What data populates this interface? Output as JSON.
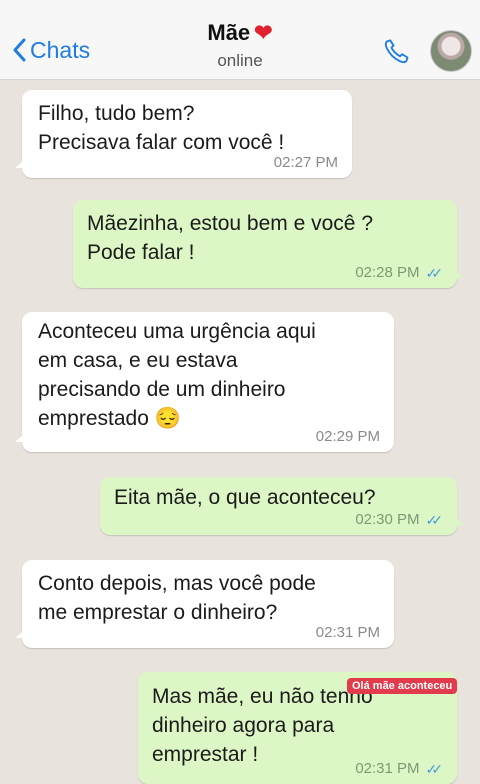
{
  "header": {
    "back_label": "Chats",
    "contact_name": "Mãe",
    "contact_emoji": "❤",
    "status": "online"
  },
  "messages": [
    {
      "direction": "in",
      "text": "Filho, tudo bem?\nPrecisava falar com você !",
      "time": "02:27 PM"
    },
    {
      "direction": "out",
      "text": "Mãezinha, estou bem e você ?\nPode falar !",
      "time": "02:28 PM"
    },
    {
      "direction": "in",
      "text": "Aconteceu uma urgência aqui\nem casa, e eu estava\nprecisando de um dinheiro\nemprestado 😔",
      "time": "02:29 PM"
    },
    {
      "direction": "out",
      "text": "Eita mãe, o que aconteceu?",
      "time": "02:30 PM"
    },
    {
      "direction": "in",
      "text": "Conto depois, mas você pode\nme emprestar o dinheiro?",
      "time": "02:31 PM"
    },
    {
      "direction": "out",
      "text": "Mas mãe, eu não tenho\ndinheiro agora para\nemprestar !",
      "time": "02:31 PM"
    }
  ],
  "overlay_label": "Olá mãe aconteceu",
  "colors": {
    "accent": "#1f7ce0",
    "outgoing_bubble": "#dcf7c5",
    "incoming_bubble": "#ffffff",
    "read_ticks": "#4a9cdf",
    "background": "#e8e3dc"
  }
}
